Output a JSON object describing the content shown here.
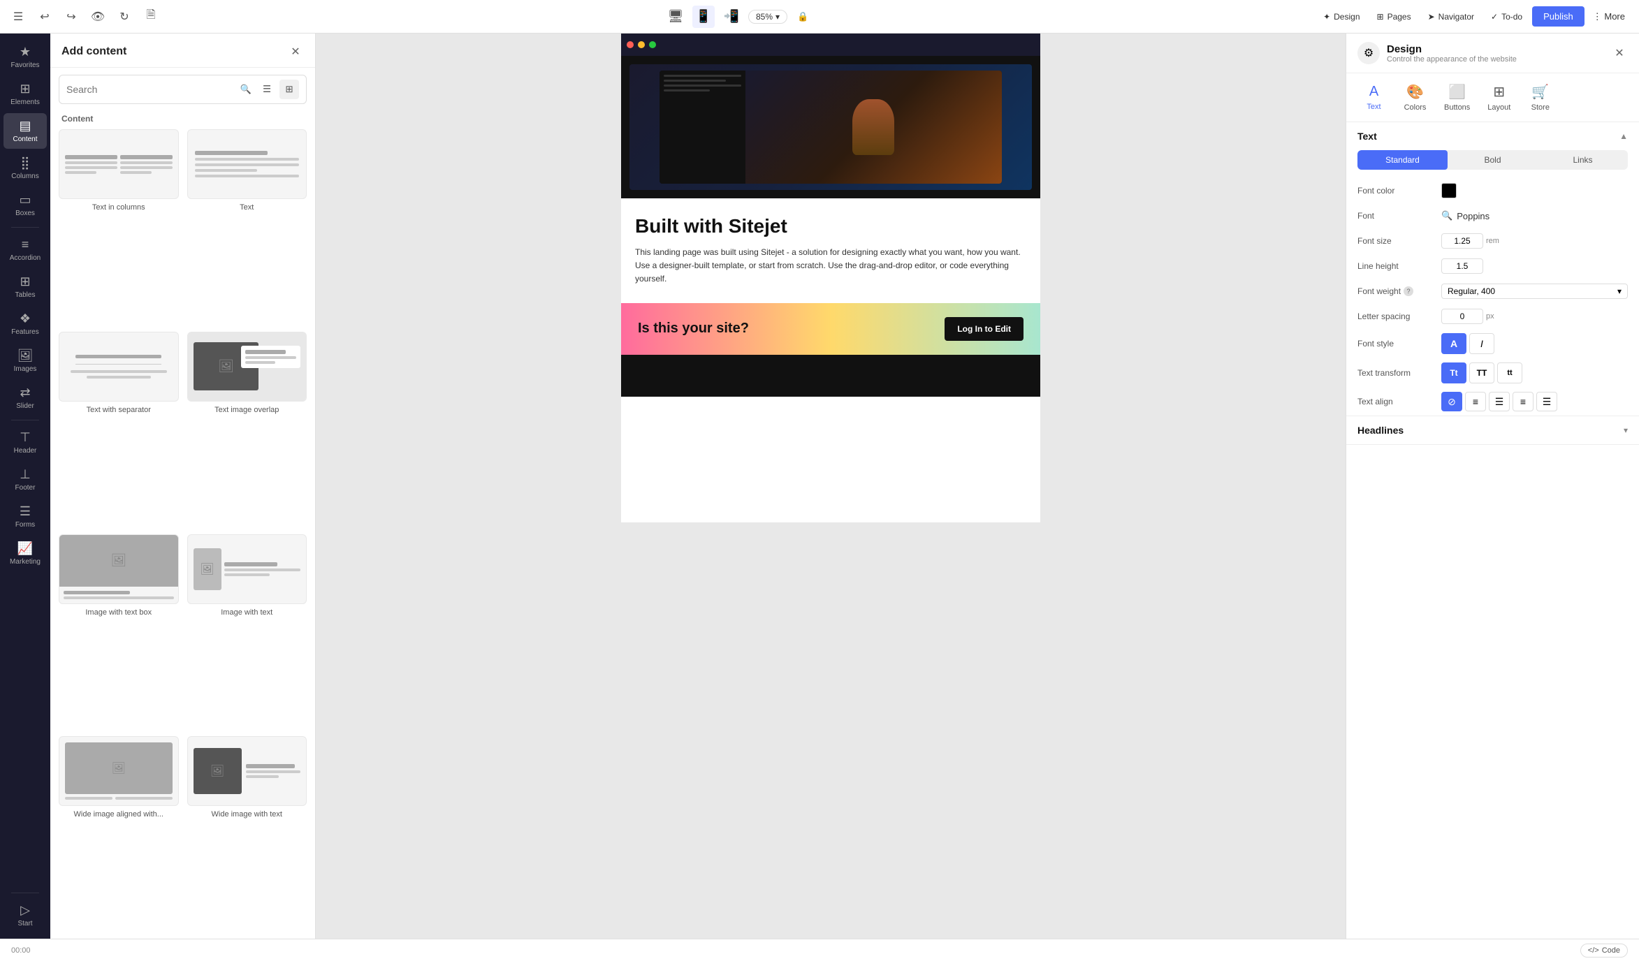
{
  "topbar": {
    "undo_label": "Undo",
    "redo_label": "Redo",
    "preview_label": "Preview",
    "refresh_label": "Refresh",
    "save_label": "Save",
    "zoom": "85%",
    "design_label": "Design",
    "pages_label": "Pages",
    "navigator_label": "Navigator",
    "todo_label": "To-do",
    "publish_label": "Publish",
    "more_label": "More",
    "hamburger_label": "Menu"
  },
  "left_sidebar": {
    "items": [
      {
        "id": "favorites",
        "label": "Favorites",
        "icon": "★"
      },
      {
        "id": "elements",
        "label": "Elements",
        "icon": "⊞"
      },
      {
        "id": "content",
        "label": "Content",
        "icon": "▤",
        "active": true
      },
      {
        "id": "columns",
        "label": "Columns",
        "icon": "⣿"
      },
      {
        "id": "boxes",
        "label": "Boxes",
        "icon": "▭"
      },
      {
        "id": "accordion",
        "label": "Accordion",
        "icon": "≡"
      },
      {
        "id": "tables",
        "label": "Tables",
        "icon": "⊞"
      },
      {
        "id": "features",
        "label": "Features",
        "icon": "❖"
      },
      {
        "id": "images",
        "label": "Images",
        "icon": "🖼"
      },
      {
        "id": "slider",
        "label": "Slider",
        "icon": "⇄"
      },
      {
        "id": "header",
        "label": "Header",
        "icon": "⊤"
      },
      {
        "id": "footer",
        "label": "Footer",
        "icon": "⊥"
      },
      {
        "id": "forms",
        "label": "Forms",
        "icon": "☰"
      },
      {
        "id": "marketing",
        "label": "Marketing",
        "icon": "📈"
      }
    ],
    "start_label": "Start"
  },
  "add_content_panel": {
    "title": "Add content",
    "search_placeholder": "Search",
    "section_label": "Content",
    "items": [
      {
        "id": "text-in-columns",
        "label": "Text in columns"
      },
      {
        "id": "text",
        "label": "Text"
      },
      {
        "id": "text-with-separator",
        "label": "Text with separator"
      },
      {
        "id": "text-image-overlap",
        "label": "Text image overlap"
      },
      {
        "id": "image-with-text-box",
        "label": "Image with text box"
      },
      {
        "id": "image-with-text",
        "label": "Image with text"
      },
      {
        "id": "wide-image-aligned",
        "label": "Wide image aligned with..."
      },
      {
        "id": "wide-image-with-text",
        "label": "Wide image with text"
      }
    ]
  },
  "canvas": {
    "heading": "Built with Sitejet",
    "body": "This landing page was built using Sitejet - a solution for designing exactly what you want, how you want. Use a designer-built template, or start from scratch. Use the drag-and-drop editor, or code everything yourself.",
    "cta_text": "Is this your site?",
    "cta_button": "Log In to Edit"
  },
  "design_panel": {
    "title": "Design",
    "subtitle": "Control the appearance of the website",
    "close_label": "Close",
    "nav_items": [
      {
        "id": "text",
        "label": "Text",
        "active": true
      },
      {
        "id": "colors",
        "label": "Colors"
      },
      {
        "id": "buttons",
        "label": "Buttons"
      },
      {
        "id": "layout",
        "label": "Layout"
      },
      {
        "id": "store",
        "label": "Store"
      }
    ],
    "text_section": {
      "title": "Text",
      "tabs": [
        {
          "id": "standard",
          "label": "Standard",
          "active": true
        },
        {
          "id": "bold",
          "label": "Bold"
        },
        {
          "id": "links",
          "label": "Links"
        }
      ],
      "properties": {
        "font_color_label": "Font color",
        "font_color_value": "#000000",
        "font_label": "Font",
        "font_value": "Poppins",
        "font_size_label": "Font size",
        "font_size_value": "1.25",
        "font_size_unit": "rem",
        "line_height_label": "Line height",
        "line_height_value": "1.5",
        "font_weight_label": "Font weight",
        "font_weight_value": "Regular, 400",
        "letter_spacing_label": "Letter spacing",
        "letter_spacing_value": "0",
        "letter_spacing_unit": "px",
        "font_style_label": "Font style",
        "font_style_bold": "A",
        "font_style_italic": "I",
        "text_transform_label": "Text transform",
        "text_transform_tt": "Tt",
        "text_transform_TT": "TT",
        "text_transform_tt_lower": "tt",
        "text_align_label": "Text align"
      }
    },
    "headlines_section": {
      "title": "Headlines"
    }
  },
  "status_bar": {
    "time": "00:00",
    "code_label": "Code"
  }
}
